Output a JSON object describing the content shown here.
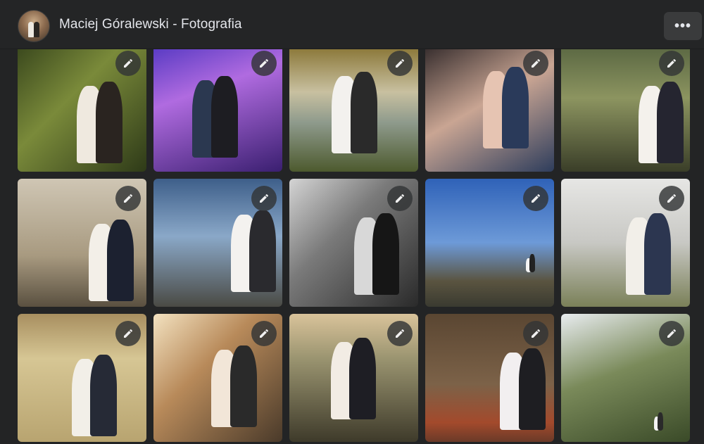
{
  "header": {
    "title": "Maciej Góralewski - Fotografia",
    "more_label": "•••"
  },
  "icons": {
    "avatar": "profile-avatar",
    "edit": "pencil-icon",
    "more": "more-options-icon"
  },
  "photos": [
    {
      "scene": "forest-couple",
      "bg": "linear-gradient(135deg,#3c4a1e 0%,#7a8a3a 40%,#2e3a18 100%)",
      "a": "#efe9df",
      "b": "#2a2420"
    },
    {
      "scene": "party-dance",
      "bg": "linear-gradient(160deg,#5b3cc4 0%,#b06be0 35%,#3a1f70 100%)",
      "a": "#2b3850",
      "b": "#1d1d22"
    },
    {
      "scene": "lake-couple",
      "bg": "linear-gradient(180deg,#8d7a3c 0%,#c8c0a0 35%,#8e9a8c 60%,#4d5a2e 100%)",
      "a": "#f3f1ee",
      "b": "#2a2a2a"
    },
    {
      "scene": "makeup-portrait",
      "bg": "linear-gradient(150deg,#3a3030 0%,#c9a593 45%,#2e3d5c 100%)",
      "a": "#e6c4b2",
      "b": "#2a3a5a"
    },
    {
      "scene": "meadow-couple",
      "bg": "linear-gradient(180deg,#5d6a44 0%,#8c9460 40%,#3a3e28 100%)",
      "a": "#f4f1ec",
      "b": "#252530"
    },
    {
      "scene": "bench-couple",
      "bg": "linear-gradient(180deg,#cfc6b4 0%,#a89a80 60%,#5a5040 100%)",
      "a": "#f3efe8",
      "b": "#1c2130"
    },
    {
      "scene": "blue-sky-rocks",
      "bg": "linear-gradient(180deg,#3e5f8a 0%,#8aa8c8 45%,#4a4a44 100%)",
      "a": "#f4f2ef",
      "b": "#2a2a2e"
    },
    {
      "scene": "bw-window",
      "bg": "linear-gradient(135deg,#d4d4d4 0%,#7a7a7a 40%,#2a2a2a 100%)",
      "a": "#d8d8d8",
      "b": "#161616"
    },
    {
      "scene": "hilltop-sky",
      "bg": "linear-gradient(180deg,#2f62b8 0%,#6d9ad8 50%,#5a5440 80%,#3a3a30 100%)",
      "a": "#f4f4f4",
      "b": "#222"
    },
    {
      "scene": "manor-couple",
      "bg": "linear-gradient(180deg,#e6e6e4 0%,#c8c8c4 50%,#7a8058 100%)",
      "a": "#f2efe9",
      "b": "#2c3650"
    },
    {
      "scene": "yellow-house-door",
      "bg": "linear-gradient(180deg,#a88f60 0%,#d6c694 35%,#b8a470 100%)",
      "a": "#f2efe8",
      "b": "#262a36"
    },
    {
      "scene": "sunset-glow",
      "bg": "linear-gradient(135deg,#f3e2c0 0%,#b88a5a 40%,#4a3a2a 100%)",
      "a": "#f2e6d8",
      "b": "#2a2a2a"
    },
    {
      "scene": "river-valley-hug",
      "bg": "linear-gradient(180deg,#d9c39a 0%,#9a9470 35%,#3e3a2a 100%)",
      "a": "#f2ece4",
      "b": "#1e1e24"
    },
    {
      "scene": "wooden-barn",
      "bg": "linear-gradient(180deg,#5a4632 0%,#7c6248 55%,#a34a2c 85%,#6a3a28 100%)",
      "a": "#f2eff0",
      "b": "#1e1e22"
    },
    {
      "scene": "windmill",
      "bg": "linear-gradient(160deg,#e8ecef 0%,#7a8a5a 45%,#3a4a28 100%)",
      "a": "#f4f4f4",
      "b": "#2a2a2a"
    }
  ]
}
